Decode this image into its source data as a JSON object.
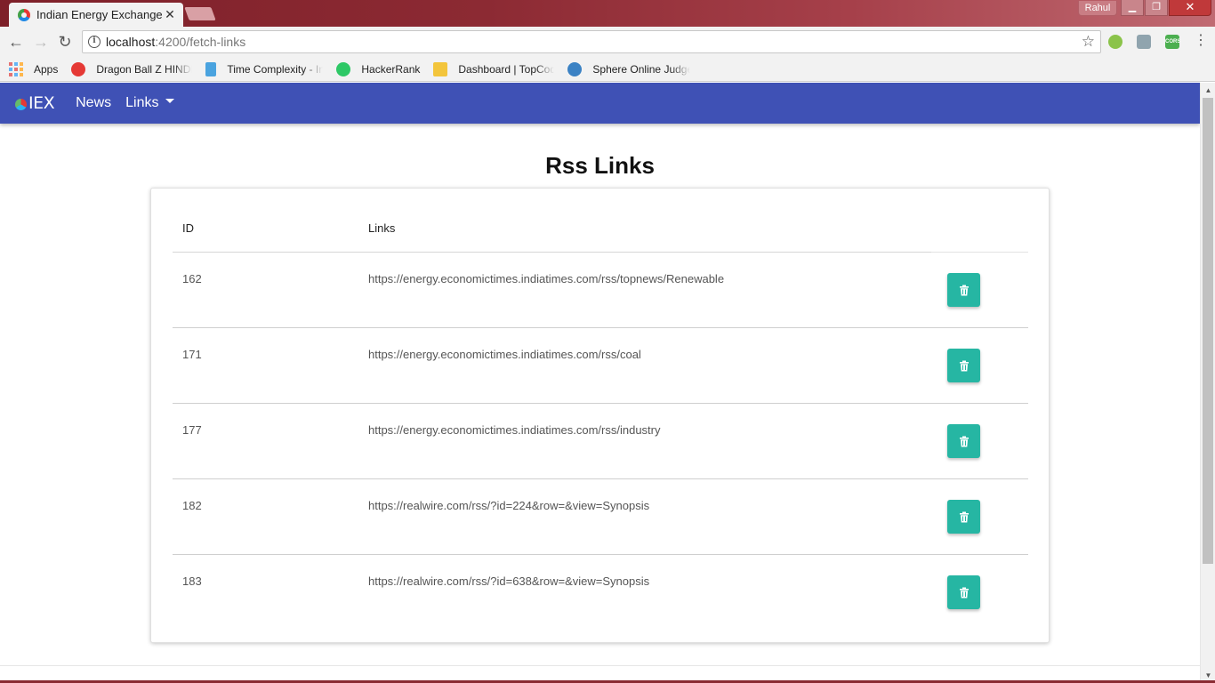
{
  "browser": {
    "tab_title": "Indian Energy Exchange",
    "tab_close": "✕",
    "profile_name": "Rahul",
    "url_host": "localhost",
    "url_path": ":4200/fetch-links",
    "bookmarks": [
      {
        "label": "Apps",
        "icon": "apps-grid-icon"
      },
      {
        "label": "Dragon Ball Z HINDI",
        "icon": "dragonball-icon",
        "color": "#e53935"
      },
      {
        "label": "Time Complexity - In",
        "icon": "interviewbit-icon",
        "color": "#4aa3df"
      },
      {
        "label": "HackerRank",
        "icon": "hackerrank-icon",
        "color": "#2ec866"
      },
      {
        "label": "Dashboard | TopCoder",
        "icon": "folder-icon",
        "color": "#f3c53c"
      },
      {
        "label": "Sphere Online Judge",
        "icon": "spoj-icon",
        "color": "#3b82c4"
      }
    ],
    "extensions": [
      {
        "name": "extension-1-icon",
        "color": "#8bc34a"
      },
      {
        "name": "extension-2-icon",
        "color": "#90a4ae"
      },
      {
        "name": "cors-extension-icon",
        "color": "#4caf50",
        "label": "CORS"
      }
    ]
  },
  "app": {
    "brand": "IEX",
    "nav": {
      "news": "News",
      "links": "Links"
    },
    "page_title": "Rss Links",
    "table": {
      "headers": {
        "id": "ID",
        "links": "Links"
      },
      "rows": [
        {
          "id": "162",
          "link": "https://energy.economictimes.indiatimes.com/rss/topnews/Renewable"
        },
        {
          "id": "171",
          "link": "https://energy.economictimes.indiatimes.com/rss/coal"
        },
        {
          "id": "177",
          "link": "https://energy.economictimes.indiatimes.com/rss/industry"
        },
        {
          "id": "182",
          "link": "https://realwire.com/rss/?id=224&row=&view=Synopsis"
        },
        {
          "id": "183",
          "link": "https://realwire.com/rss/?id=638&row=&view=Synopsis"
        }
      ]
    },
    "colors": {
      "navbar": "#3f51b5",
      "delete_button": "#26b6a3"
    }
  }
}
